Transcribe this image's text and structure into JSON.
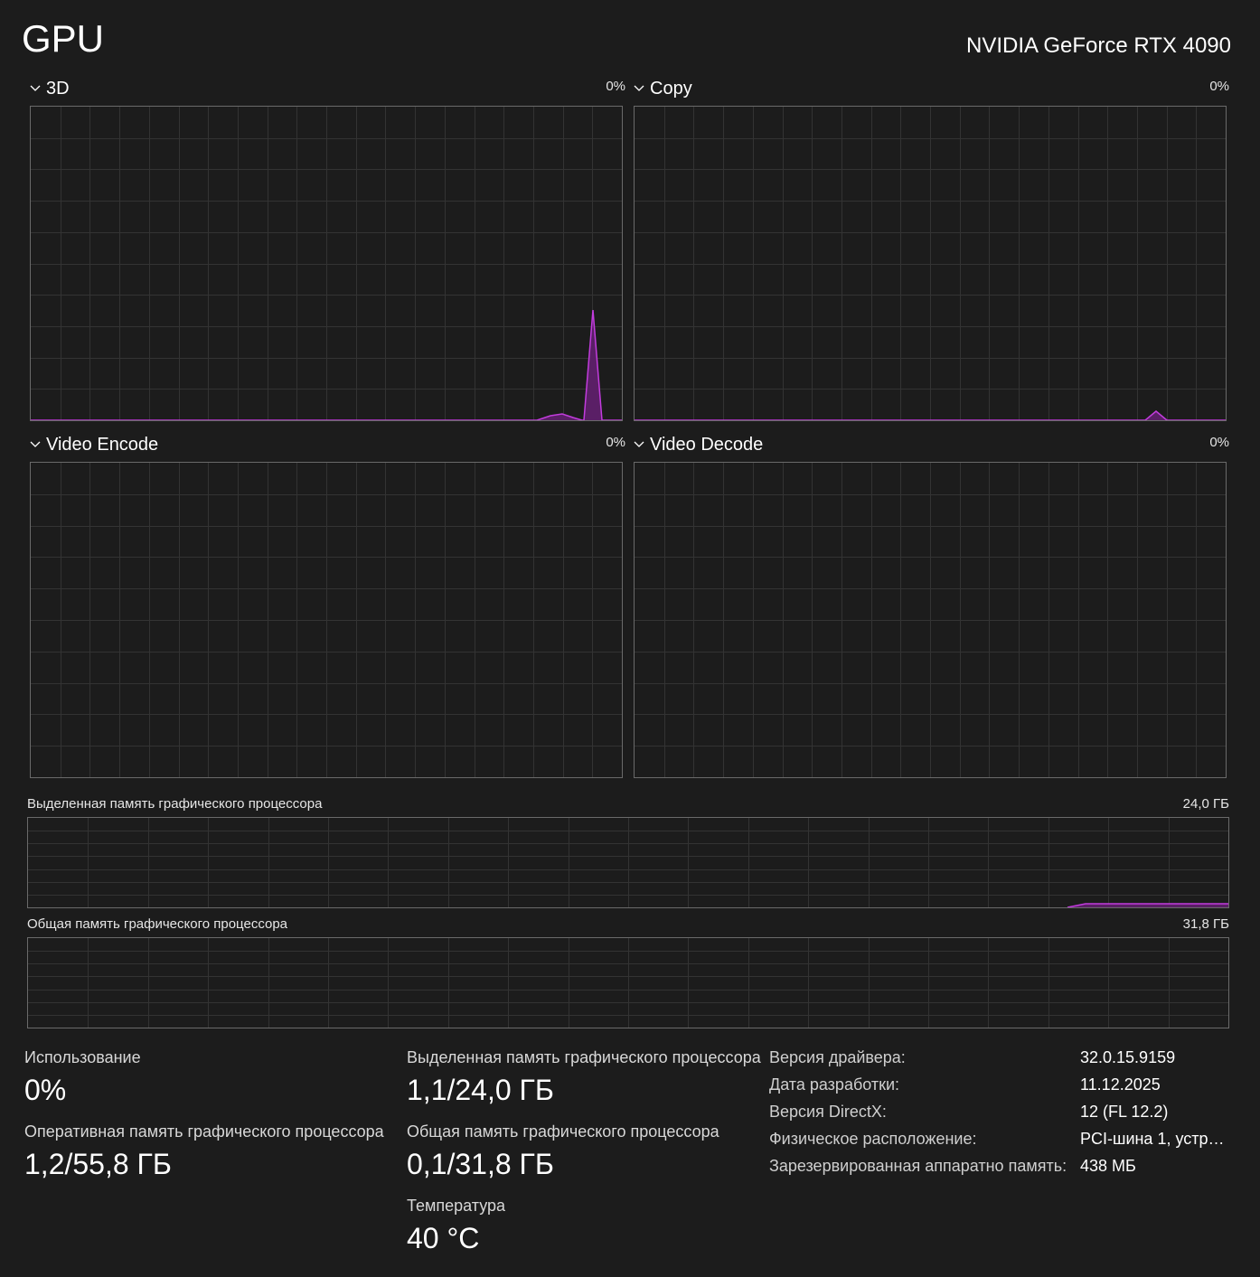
{
  "header": {
    "title": "GPU",
    "device_name": "NVIDIA GeForce RTX 4090"
  },
  "engines": [
    {
      "label": "3D",
      "percent": "0%"
    },
    {
      "label": "Copy",
      "percent": "0%"
    },
    {
      "label": "Video Encode",
      "percent": "0%"
    },
    {
      "label": "Video Decode",
      "percent": "0%"
    }
  ],
  "memory_graphs": {
    "dedicated": {
      "label": "Выделенная память графического процессора",
      "max": "24,0 ГБ"
    },
    "shared": {
      "label": "Общая память графического процессора",
      "max": "31,8 ГБ"
    }
  },
  "stats": {
    "utilization": {
      "label": "Использование",
      "value": "0%"
    },
    "gpu_memory": {
      "label": "Оперативная память графического процессора",
      "value": "1,2/55,8 ГБ"
    },
    "dedicated_memory": {
      "label": "Выделенная память графического процессора",
      "value": "1,1/24,0 ГБ"
    },
    "shared_memory": {
      "label": "Общая память графического процессора",
      "value": "0,1/31,8 ГБ"
    },
    "temperature": {
      "label": "Температура",
      "value": "40 °C"
    }
  },
  "info": [
    {
      "key": "Версия драйвера:",
      "value": "32.0.15.9159"
    },
    {
      "key": "Дата разработки:",
      "value": "11.12.2025"
    },
    {
      "key": "Версия DirectX:",
      "value": "12 (FL 12.2)"
    },
    {
      "key": "Физическое расположение:",
      "value": "PCI-шина 1, устро..."
    },
    {
      "key": "Зарезервированная аппаратно память:",
      "value": "438 МБ"
    }
  ],
  "colors": {
    "background": "#1c1c1c",
    "grid": "#333333",
    "border": "#6a6a6a",
    "accent": "#c23cdd",
    "fill": "#5a1f66"
  }
}
